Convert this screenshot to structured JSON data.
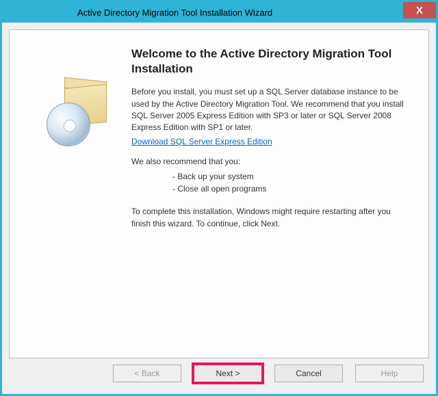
{
  "title": "Active Directory Migration Tool Installation Wizard",
  "close": "X",
  "heading": "Welcome to the Active Directory Migration Tool Installation",
  "intro": "Before you install, you must set up a SQL Server database instance to be used by the Active Directory Migration Tool. We recommend that you install SQL Server 2005 Express Edition with SP3 or later or SQL Server 2008 Express Edition with SP1 or later.",
  "link": "Download SQL Server Express Edition",
  "recIntro": "We also recommend that you:",
  "rec1": "- Back up your system",
  "rec2": "- Close all open programs",
  "outro": "To complete this installation, Windows might require restarting after you finish this wizard. To continue, click Next.",
  "buttons": {
    "back": "< Back",
    "next": "Next >",
    "cancel": "Cancel",
    "help": "Help"
  }
}
